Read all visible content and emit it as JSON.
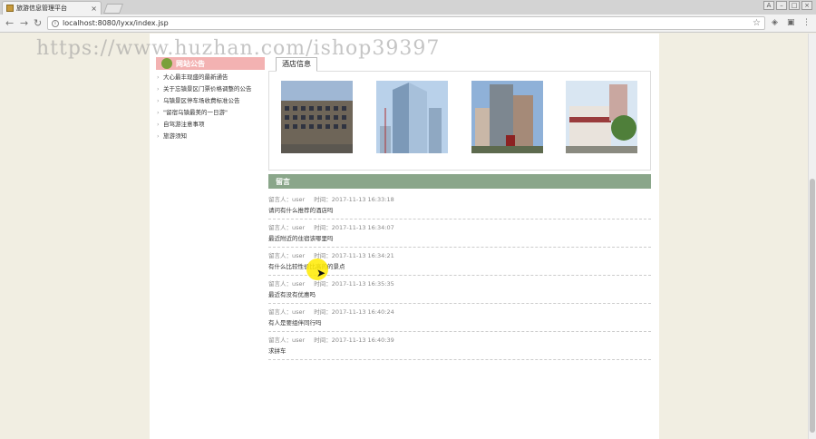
{
  "browser": {
    "tab_title": "旅游信息管理平台",
    "url": "localhost:8080/lyxx/index.jsp",
    "back_icon": "back-arrow-icon",
    "forward_icon": "forward-arrow-icon",
    "reload_icon": "reload-icon"
  },
  "watermark": "https://www.huzhan.com/ishop39397",
  "sidebar": {
    "title": "网站公告",
    "items": [
      "大心最丰现盛的最新通告",
      "关于忘镇景区门票价格调整的公告",
      "乌镇景区停车场收费标准公告",
      "\"留宿乌镇最美的一日游\"",
      "自驾游注意事项",
      "旅游须知"
    ]
  },
  "hotel": {
    "tab_label": "酒店信息",
    "images": [
      "hotel-building-1",
      "hotel-tower-2",
      "hotel-highrise-3",
      "hotel-low-building-4"
    ]
  },
  "messages": {
    "title": "留言",
    "items": [
      {
        "author": "留言人：user",
        "time": "时间：2017-11-13 16:33:18",
        "content": "请问有什么推荐的酒店吗"
      },
      {
        "author": "留言人：user",
        "time": "时间：2017-11-13 16:34:07",
        "content": "最近附近的住宿该哪里吗"
      },
      {
        "author": "留言人：user",
        "time": "时间：2017-11-13 16:34:21",
        "content": "有什么比较性价比高的的景点"
      },
      {
        "author": "留言人：user",
        "time": "时间：2017-11-13 16:35:35",
        "content": "最近有没有优惠吗"
      },
      {
        "author": "留言人：user",
        "time": "时间：2017-11-13 16:40:24",
        "content": "有人是要组伴同行吗"
      },
      {
        "author": "留言人：user",
        "time": "时间：2017-11-13 16:40:39",
        "content": "求拼车"
      }
    ]
  }
}
